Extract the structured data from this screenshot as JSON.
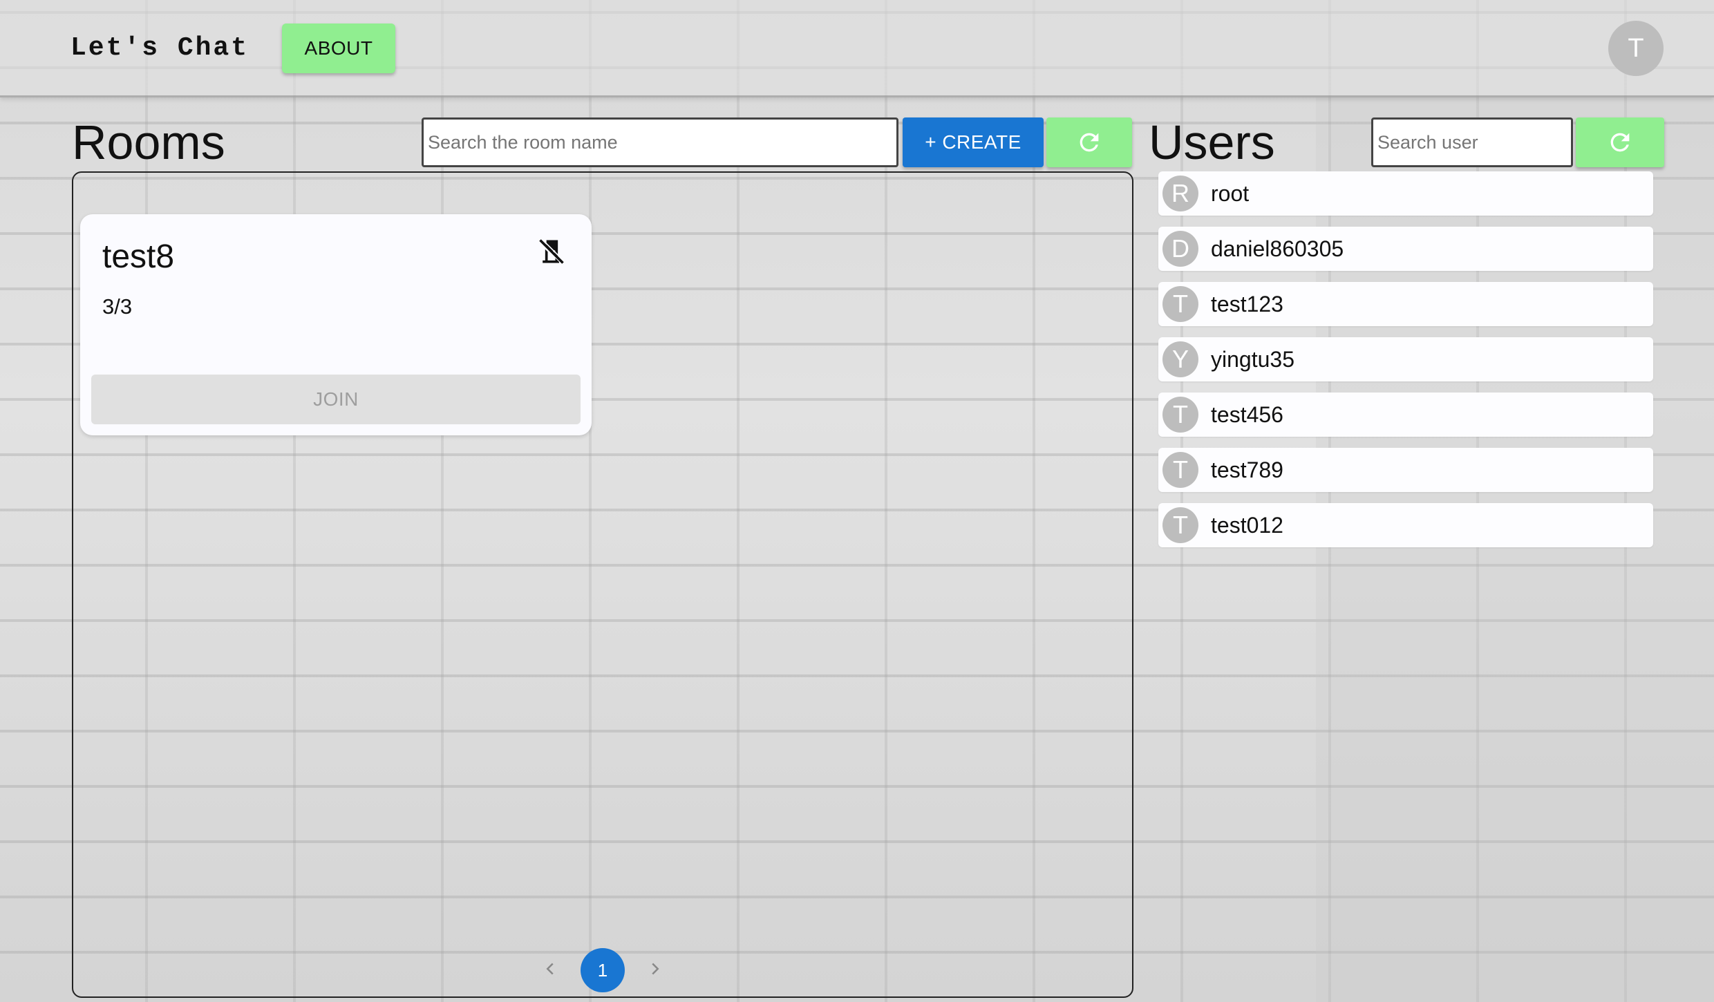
{
  "appbar": {
    "brand": "Let's Chat",
    "about_label": "ABOUT",
    "avatar_initial": "T",
    "accent_color": "#90ee90"
  },
  "rooms": {
    "title": "Rooms",
    "search_placeholder": "Search the room name",
    "create_label": "+ CREATE",
    "refresh_icon": "refresh-icon",
    "cards": [
      {
        "name": "test8",
        "count": "3/3",
        "status_icon": "no-entry-door-icon",
        "join_label": "JOIN",
        "join_disabled": true
      }
    ],
    "pagination": {
      "current_page": "1",
      "prev_icon": "chevron-left-icon",
      "next_icon": "chevron-right-icon"
    },
    "primary_color": "#1976d2"
  },
  "users": {
    "title": "Users",
    "search_placeholder": "Search user",
    "refresh_icon": "refresh-icon",
    "items": [
      {
        "initial": "R",
        "name": "root"
      },
      {
        "initial": "D",
        "name": "daniel860305"
      },
      {
        "initial": "T",
        "name": "test123"
      },
      {
        "initial": "Y",
        "name": "yingtu35"
      },
      {
        "initial": "T",
        "name": "test456"
      },
      {
        "initial": "T",
        "name": "test789"
      },
      {
        "initial": "T",
        "name": "test012"
      }
    ]
  }
}
